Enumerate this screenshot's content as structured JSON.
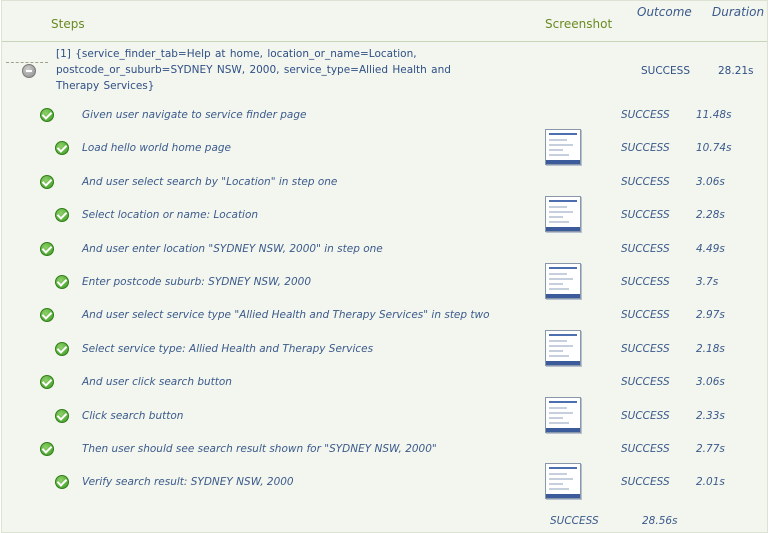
{
  "headers": {
    "steps": "Steps",
    "screenshot": "Screenshot",
    "outcome": "Outcome",
    "duration": "Duration"
  },
  "root": {
    "text": "[1] {service_finder_tab=Help at home, location_or_name=Location, postcode_or_suburb=SYDNEY NSW, 2000, service_type=Allied Health and Therapy Services}",
    "outcome": "SUCCESS",
    "duration": "28.21s"
  },
  "steps": [
    {
      "label": "Given user navigate to service finder page",
      "outcome": "SUCCESS",
      "duration": "11.48s",
      "has_screenshot": false
    },
    {
      "label": "Load hello world home page",
      "outcome": "SUCCESS",
      "duration": "10.74s",
      "has_screenshot": true
    },
    {
      "label": "And user select search by \"Location\" in step one",
      "outcome": "SUCCESS",
      "duration": "3.06s",
      "has_screenshot": false
    },
    {
      "label": "Select location or name: Location",
      "outcome": "SUCCESS",
      "duration": "2.28s",
      "has_screenshot": true
    },
    {
      "label": "And user enter location \"SYDNEY NSW, 2000\" in step one",
      "outcome": "SUCCESS",
      "duration": "4.49s",
      "has_screenshot": false
    },
    {
      "label": "Enter postcode suburb: SYDNEY NSW, 2000",
      "outcome": "SUCCESS",
      "duration": "3.7s",
      "has_screenshot": true
    },
    {
      "label": "And user select service type \"Allied Health and Therapy Services\" in step two",
      "outcome": "SUCCESS",
      "duration": "2.97s",
      "has_screenshot": false
    },
    {
      "label": "Select service type: Allied Health and Therapy Services",
      "outcome": "SUCCESS",
      "duration": "2.18s",
      "has_screenshot": true
    },
    {
      "label": "And user click search button",
      "outcome": "SUCCESS",
      "duration": "3.06s",
      "has_screenshot": false
    },
    {
      "label": "Click search button",
      "outcome": "SUCCESS",
      "duration": "2.33s",
      "has_screenshot": true
    },
    {
      "label": "Then user should see search result shown for \"SYDNEY NSW, 2000\"",
      "outcome": "SUCCESS",
      "duration": "2.77s",
      "has_screenshot": false
    },
    {
      "label": "Verify search result: SYDNEY NSW, 2000",
      "outcome": "SUCCESS",
      "duration": "2.01s",
      "has_screenshot": true
    }
  ],
  "total": {
    "outcome": "SUCCESS",
    "duration": "28.56s"
  },
  "icons": {
    "root": "collapse-minus-icon",
    "step": "success-check-icon"
  },
  "colors": {
    "header_text": "#6a8a22",
    "step_text": "#3b5a8c",
    "success_icon": "#3c9a22",
    "background": "#f3f6ee"
  }
}
